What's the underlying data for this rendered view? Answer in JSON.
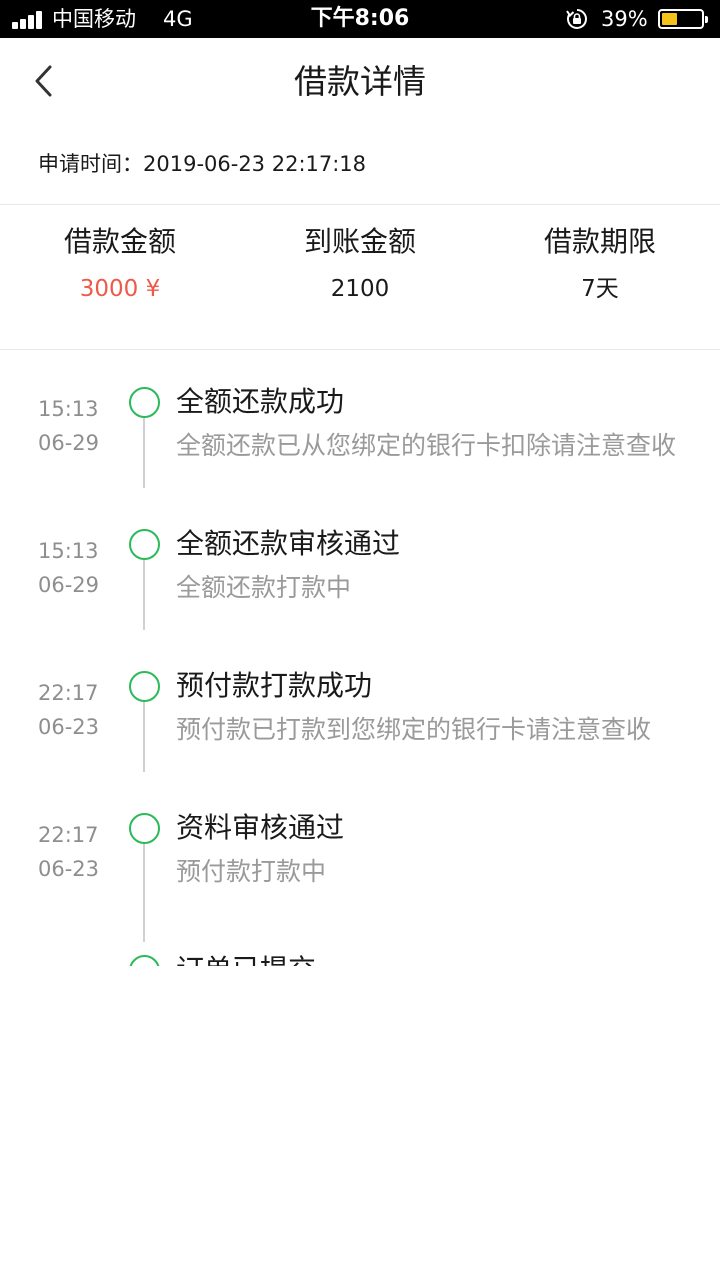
{
  "status_bar": {
    "carrier": "中国移动",
    "network": "4G",
    "time": "下午8:06",
    "battery_percent": "39%",
    "battery_level": 0.39,
    "battery_color": "#f5c21b",
    "icons": [
      "signal-icon",
      "rotation-lock-icon",
      "battery-icon"
    ]
  },
  "nav": {
    "title": "借款详情",
    "back_icon": "chevron-left-icon"
  },
  "apply": {
    "label": "申请时间：",
    "value": "2019-06-23 22:17:18"
  },
  "summary": {
    "items": [
      {
        "label": "借款金额",
        "value": "3000 ¥",
        "color": "#ee5a48"
      },
      {
        "label": "到账金额",
        "value": "2100"
      },
      {
        "label": "借款期限",
        "value": "7天"
      }
    ]
  },
  "timeline": {
    "accent": "#2bba5a",
    "items": [
      {
        "time": "15:13",
        "date": "06-29",
        "title": "全额还款成功",
        "desc": "全额还款已从您绑定的银行卡扣除请注意查收"
      },
      {
        "time": "15:13",
        "date": "06-29",
        "title": "全额还款审核通过",
        "desc": "全额还款打款中"
      },
      {
        "time": "22:17",
        "date": "06-23",
        "title": "预付款打款成功",
        "desc": "预付款已打款到您绑定的银行卡请注意查收"
      },
      {
        "time": "22:17",
        "date": "06-23",
        "title": "资料审核通过",
        "desc": "预付款打款中"
      },
      {
        "time": "",
        "date": "",
        "title": "订单已提交",
        "desc": ""
      }
    ]
  }
}
